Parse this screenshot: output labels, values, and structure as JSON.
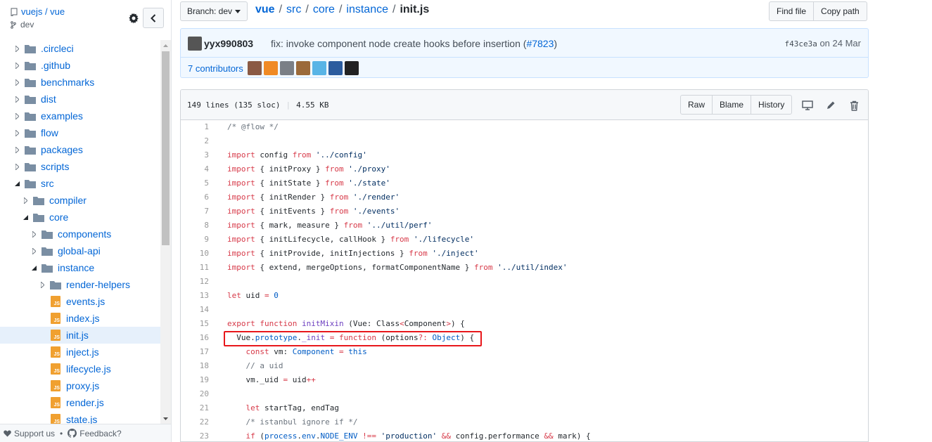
{
  "sidebar": {
    "repo": "vuejs / vue",
    "branch": "dev",
    "items": [
      {
        "label": ".circleci",
        "type": "folder",
        "depth": 0,
        "open": false
      },
      {
        "label": ".github",
        "type": "folder",
        "depth": 0,
        "open": false
      },
      {
        "label": "benchmarks",
        "type": "folder",
        "depth": 0,
        "open": false
      },
      {
        "label": "dist",
        "type": "folder",
        "depth": 0,
        "open": false
      },
      {
        "label": "examples",
        "type": "folder",
        "depth": 0,
        "open": false
      },
      {
        "label": "flow",
        "type": "folder",
        "depth": 0,
        "open": false
      },
      {
        "label": "packages",
        "type": "folder",
        "depth": 0,
        "open": false
      },
      {
        "label": "scripts",
        "type": "folder",
        "depth": 0,
        "open": false
      },
      {
        "label": "src",
        "type": "folder",
        "depth": 0,
        "open": true
      },
      {
        "label": "compiler",
        "type": "folder",
        "depth": 1,
        "open": false
      },
      {
        "label": "core",
        "type": "folder",
        "depth": 1,
        "open": true
      },
      {
        "label": "components",
        "type": "folder",
        "depth": 2,
        "open": false
      },
      {
        "label": "global-api",
        "type": "folder",
        "depth": 2,
        "open": false
      },
      {
        "label": "instance",
        "type": "folder",
        "depth": 2,
        "open": true
      },
      {
        "label": "render-helpers",
        "type": "folder",
        "depth": 3,
        "open": false
      },
      {
        "label": "events.js",
        "type": "file",
        "depth": 3
      },
      {
        "label": "index.js",
        "type": "file",
        "depth": 3
      },
      {
        "label": "init.js",
        "type": "file",
        "depth": 3,
        "selected": true
      },
      {
        "label": "inject.js",
        "type": "file",
        "depth": 3
      },
      {
        "label": "lifecycle.js",
        "type": "file",
        "depth": 3
      },
      {
        "label": "proxy.js",
        "type": "file",
        "depth": 3
      },
      {
        "label": "render.js",
        "type": "file",
        "depth": 3
      },
      {
        "label": "state.js",
        "type": "file",
        "depth": 3
      }
    ],
    "footer": {
      "support": "Support us",
      "dot": "•",
      "feedback": "Feedback?"
    }
  },
  "toolbar": {
    "branch_label": "Branch: dev",
    "breadcrumb": [
      "vue",
      "src",
      "core",
      "instance"
    ],
    "separator": "/",
    "current_file": "init.js",
    "find_file": "Find file",
    "copy_path": "Copy path"
  },
  "commit": {
    "author": "yyx990803",
    "message": "fix: invoke component node create hooks before insertion (",
    "pr": "#7823",
    "close": ")",
    "sha": "f43ce3a",
    "date": "on 24 Mar",
    "contributors": "7 contributors",
    "avatar_colors": [
      "#8a5a44",
      "#f08a24",
      "#7a7f86",
      "#9b6a3a",
      "#58b4e6",
      "#2b5c9e",
      "#222222"
    ]
  },
  "file": {
    "lines": "149 lines (135 sloc)",
    "size": "4.55 KB",
    "raw": "Raw",
    "blame": "Blame",
    "history": "History"
  },
  "code": [
    {
      "n": "1",
      "t": [
        [
          "cm",
          "/* @flow */"
        ]
      ]
    },
    {
      "n": "2",
      "t": []
    },
    {
      "n": "3",
      "t": [
        [
          "kw",
          "import"
        ],
        [
          "",
          " config "
        ],
        [
          "kw",
          "from"
        ],
        [
          "",
          " "
        ],
        [
          "str",
          "'../config'"
        ]
      ]
    },
    {
      "n": "4",
      "t": [
        [
          "kw",
          "import"
        ],
        [
          "",
          " { initProxy } "
        ],
        [
          "kw",
          "from"
        ],
        [
          "",
          " "
        ],
        [
          "str",
          "'./proxy'"
        ]
      ]
    },
    {
      "n": "5",
      "t": [
        [
          "kw",
          "import"
        ],
        [
          "",
          " { initState } "
        ],
        [
          "kw",
          "from"
        ],
        [
          "",
          " "
        ],
        [
          "str",
          "'./state'"
        ]
      ]
    },
    {
      "n": "6",
      "t": [
        [
          "kw",
          "import"
        ],
        [
          "",
          " { initRender } "
        ],
        [
          "kw",
          "from"
        ],
        [
          "",
          " "
        ],
        [
          "str",
          "'./render'"
        ]
      ]
    },
    {
      "n": "7",
      "t": [
        [
          "kw",
          "import"
        ],
        [
          "",
          " { initEvents } "
        ],
        [
          "kw",
          "from"
        ],
        [
          "",
          " "
        ],
        [
          "str",
          "'./events'"
        ]
      ]
    },
    {
      "n": "8",
      "t": [
        [
          "kw",
          "import"
        ],
        [
          "",
          " { mark, measure } "
        ],
        [
          "kw",
          "from"
        ],
        [
          "",
          " "
        ],
        [
          "str",
          "'../util/perf'"
        ]
      ]
    },
    {
      "n": "9",
      "t": [
        [
          "kw",
          "import"
        ],
        [
          "",
          " { initLifecycle, callHook } "
        ],
        [
          "kw",
          "from"
        ],
        [
          "",
          " "
        ],
        [
          "str",
          "'./lifecycle'"
        ]
      ]
    },
    {
      "n": "10",
      "t": [
        [
          "kw",
          "import"
        ],
        [
          "",
          " { initProvide, initInjections } "
        ],
        [
          "kw",
          "from"
        ],
        [
          "",
          " "
        ],
        [
          "str",
          "'./inject'"
        ]
      ]
    },
    {
      "n": "11",
      "t": [
        [
          "kw",
          "import"
        ],
        [
          "",
          " { extend, mergeOptions, formatComponentName } "
        ],
        [
          "kw",
          "from"
        ],
        [
          "",
          " "
        ],
        [
          "str",
          "'../util/index'"
        ]
      ]
    },
    {
      "n": "12",
      "t": []
    },
    {
      "n": "13",
      "t": [
        [
          "kw",
          "let"
        ],
        [
          "",
          " uid "
        ],
        [
          "kw",
          "="
        ],
        [
          "",
          " "
        ],
        [
          "cn",
          "0"
        ]
      ]
    },
    {
      "n": "14",
      "t": []
    },
    {
      "n": "15",
      "t": [
        [
          "kw",
          "export"
        ],
        [
          "",
          " "
        ],
        [
          "kw",
          "function"
        ],
        [
          "",
          " "
        ],
        [
          "fn",
          "initMixin"
        ],
        [
          "",
          " (Vue: Class"
        ],
        [
          "kw",
          "<"
        ],
        [
          "",
          "Component"
        ],
        [
          "kw",
          ">"
        ],
        [
          "",
          ") {"
        ]
      ]
    },
    {
      "n": "16",
      "t": [
        [
          "",
          "  Vue."
        ],
        [
          "cn",
          "prototype"
        ],
        [
          "",
          "."
        ],
        [
          "fn",
          "_init"
        ],
        [
          "",
          " "
        ],
        [
          "kw",
          "="
        ],
        [
          "",
          " "
        ],
        [
          "kw",
          "function"
        ],
        [
          "",
          " (options"
        ],
        [
          "kw",
          "?:"
        ],
        [
          "",
          " "
        ],
        [
          "cn",
          "Object"
        ],
        [
          "",
          ") {"
        ]
      ]
    },
    {
      "n": "17",
      "t": [
        [
          "",
          "    "
        ],
        [
          "kw",
          "const"
        ],
        [
          "",
          " vm: "
        ],
        [
          "cn",
          "Component"
        ],
        [
          "",
          " "
        ],
        [
          "kw",
          "="
        ],
        [
          "",
          " "
        ],
        [
          "cn",
          "this"
        ]
      ]
    },
    {
      "n": "18",
      "t": [
        [
          "",
          "    "
        ],
        [
          "cm",
          "// a uid"
        ]
      ]
    },
    {
      "n": "19",
      "t": [
        [
          "",
          "    vm._uid "
        ],
        [
          "kw",
          "="
        ],
        [
          "",
          " uid"
        ],
        [
          "kw",
          "++"
        ]
      ]
    },
    {
      "n": "20",
      "t": []
    },
    {
      "n": "21",
      "t": [
        [
          "",
          "    "
        ],
        [
          "kw",
          "let"
        ],
        [
          "",
          " startTag, endTag"
        ]
      ]
    },
    {
      "n": "22",
      "t": [
        [
          "",
          "    "
        ],
        [
          "cm",
          "/* istanbul ignore if */"
        ]
      ]
    },
    {
      "n": "23",
      "t": [
        [
          "",
          "    "
        ],
        [
          "kw",
          "if"
        ],
        [
          "",
          " ("
        ],
        [
          "cn",
          "process"
        ],
        [
          "",
          "."
        ],
        [
          "cn",
          "env"
        ],
        [
          "",
          "."
        ],
        [
          "cn",
          "NODE_ENV"
        ],
        [
          "",
          " "
        ],
        [
          "kw",
          "!=="
        ],
        [
          "",
          " "
        ],
        [
          "str",
          "'production'"
        ],
        [
          "",
          " "
        ],
        [
          "kw",
          "&&"
        ],
        [
          "",
          " config.performance "
        ],
        [
          "kw",
          "&&"
        ],
        [
          "",
          " mark) {"
        ]
      ]
    }
  ]
}
